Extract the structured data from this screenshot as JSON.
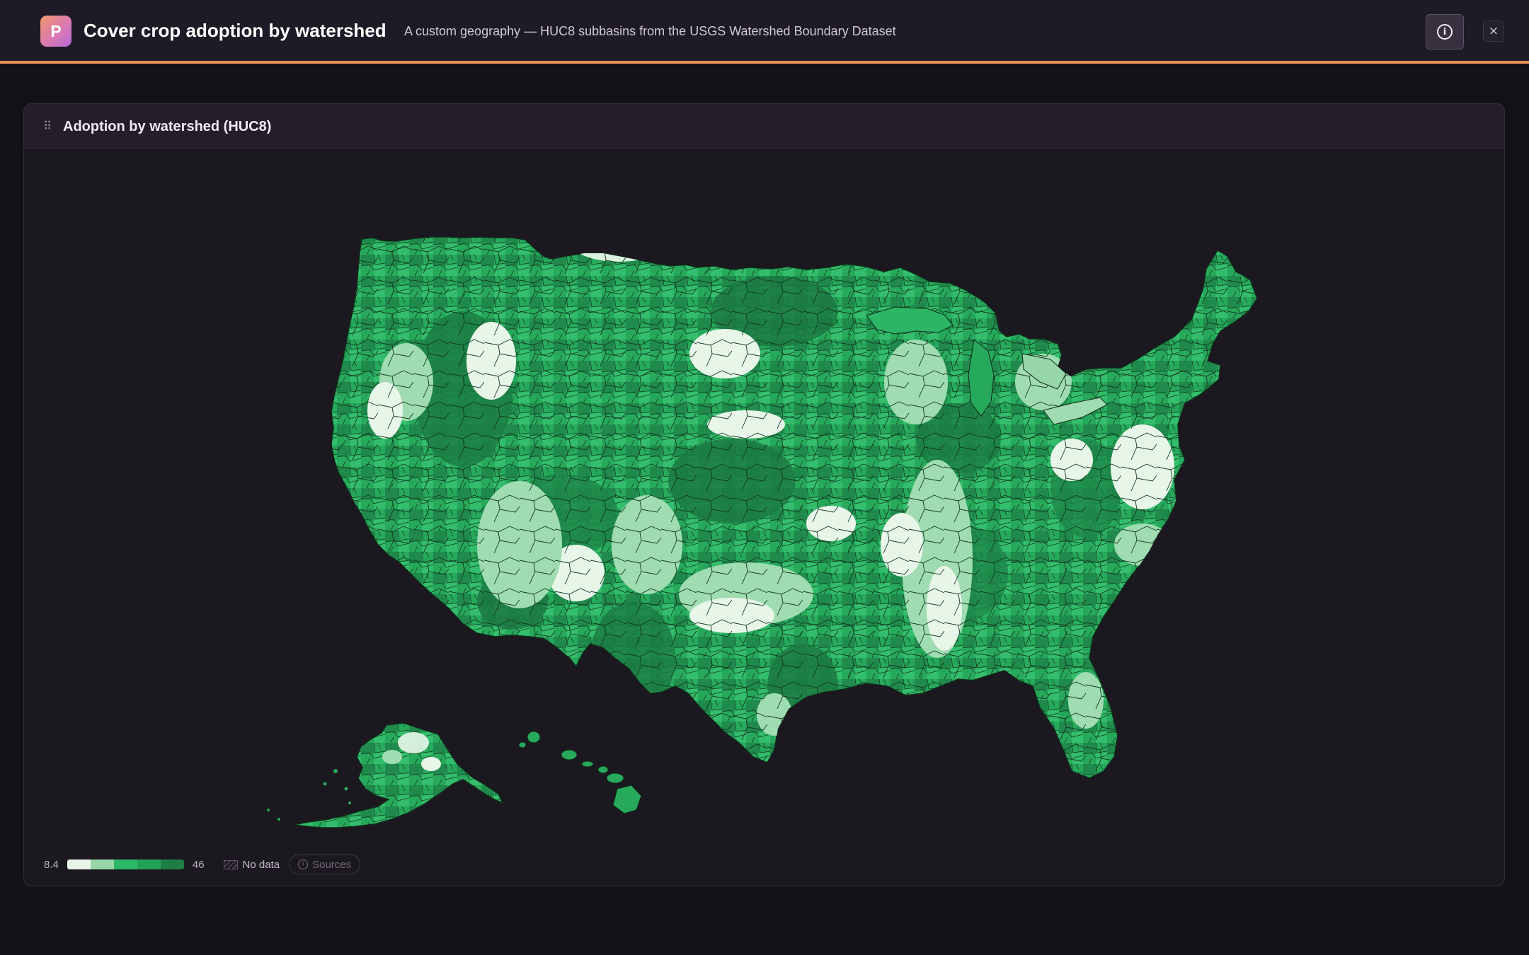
{
  "header": {
    "logo_letter": "P",
    "title": "Cover crop adoption by watershed",
    "subtitle": "A custom geography — HUC8 subbasins from the USGS Watershed Boundary Dataset",
    "info_icon": "info-icon",
    "close_icon": "close-icon",
    "close_glyph": "×",
    "accent_color": "#e6955a"
  },
  "panel": {
    "title": "Adoption by watershed (HUC8)",
    "drag_icon": "drag-handle-icon"
  },
  "map": {
    "geography": "HUC8 subbasins",
    "regions_shown": [
      "Contiguous United States",
      "Alaska",
      "Hawaii"
    ],
    "color_ramp": [
      "#e8f6ea",
      "#96d6a8",
      "#2eb866",
      "#23a156",
      "#1d7d45"
    ],
    "no_data_color": "#4a4452",
    "boundary_color": "#1a1a1a"
  },
  "legend": {
    "min": "8.4",
    "max": "46",
    "no_data_label": "No data",
    "sources_label": "Sources"
  }
}
